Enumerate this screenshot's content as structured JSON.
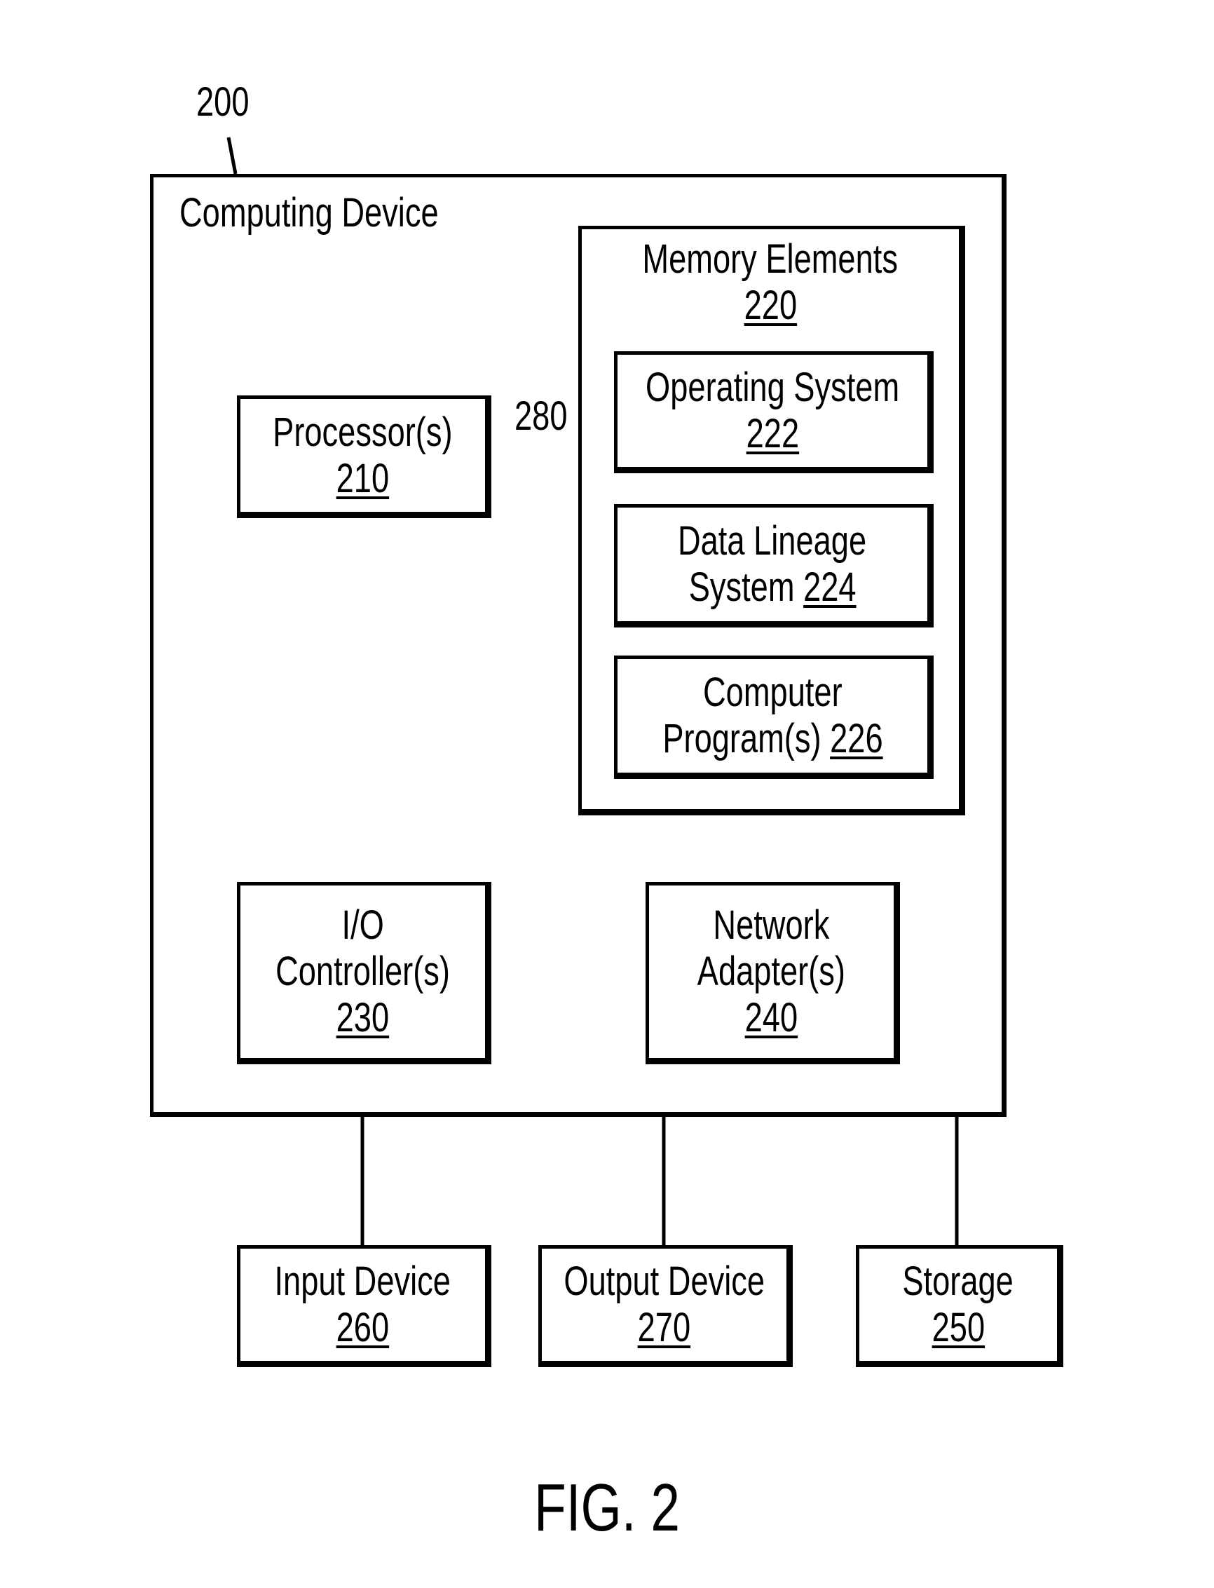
{
  "figure_ref": "200",
  "device": {
    "title": "Computing Device"
  },
  "bus_ref": "280",
  "memory": {
    "title": "Memory Elements",
    "ref": "220"
  },
  "os": {
    "title": "Operating System",
    "ref": "222"
  },
  "lineage": {
    "line1": "Data Lineage",
    "line2": "System",
    "ref": "224"
  },
  "programs": {
    "line1": "Computer",
    "line2": "Program(s)",
    "ref": "226"
  },
  "processor": {
    "title": "Processor(s)",
    "ref": "210"
  },
  "io": {
    "line1": "I/O",
    "line2": "Controller(s)",
    "ref": "230"
  },
  "network": {
    "line1": "Network",
    "line2": "Adapter(s)",
    "ref": "240"
  },
  "input": {
    "title": "Input Device",
    "ref": "260"
  },
  "output": {
    "title": "Output Device",
    "ref": "270"
  },
  "storage": {
    "title": "Storage",
    "ref": "250"
  },
  "caption": "FIG. 2"
}
